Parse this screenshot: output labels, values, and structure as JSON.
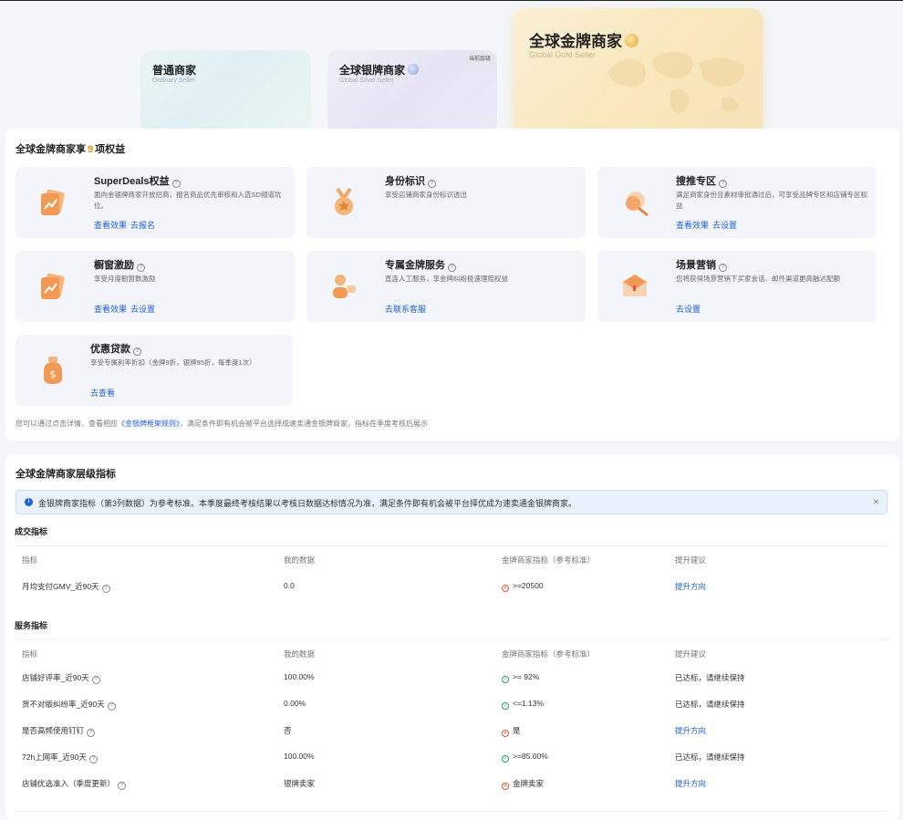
{
  "tiers": {
    "ordinary": {
      "name": "普通商家",
      "sub": "Ordinary Seller"
    },
    "silver": {
      "name": "全球银牌商家",
      "sub": "Global Silver Seller",
      "tag": "当前层级"
    },
    "gold": {
      "name": "全球金牌商家",
      "sub": "Global Gold Seller"
    }
  },
  "benefits": {
    "title_prefix": "全球金牌商家享",
    "count": "9",
    "title_suffix": "项权益",
    "items": [
      {
        "title": "SuperDeals权益",
        "desc": "面向金银牌商家开放招商，报名商品优先审核和入选SD频道坑位。",
        "links": [
          "查看效果",
          "去报名"
        ]
      },
      {
        "title": "身份标识",
        "desc": "享受店铺商家身份标识透出",
        "links": []
      },
      {
        "title": "搜推专区",
        "desc": "满足商家身份且素材审批通过后，可享受品牌专区和店铺专区权益",
        "links": [
          "查看效果",
          "去设置"
        ]
      },
      {
        "title": "橱窗激励",
        "desc": "享受月度橱窗数激励",
        "links": [
          "查看效果",
          "去设置"
        ]
      },
      {
        "title": "专属金牌服务",
        "desc": "直连人工服务，享金牌纠纷极速理赔权益",
        "links": [
          "去联系客服"
        ]
      },
      {
        "title": "场景营销",
        "desc": "您将获得场景营销下买家会话、邮件渠道更高触达配额",
        "links": [
          "去设置"
        ]
      },
      {
        "title": "优惠贷款",
        "desc": "享受专属利率折扣（金牌9折，银牌95折，每季度1次）",
        "links": [
          "去查看"
        ]
      }
    ],
    "footnote_a": "您可以通过点击详情，查看相应",
    "footnote_link": "《金银牌框架规则》",
    "footnote_b": "，满足条件即有机会被平台选择成速卖通金银牌商家，指标在季度考核后展示"
  },
  "metrics": {
    "title": "全球金牌商家层级指标",
    "alert": "金银牌商家指标（第3列数据）为参考标准。本季度最终考核结果以考核日数据达标情况为准，满足条件即有机会被平台择优成为速卖通金银牌商家。",
    "headers": [
      "指标",
      "我的数据",
      "金牌商家指标（参考标准）",
      "提升建议"
    ],
    "deal_section": "成交指标",
    "deal_rows": [
      {
        "metric": "月均支付GMV_近90天",
        "mine": "0.0",
        "standard": ">=20500",
        "status": "fail",
        "advice": "提升方向",
        "advice_link": true
      }
    ],
    "service_section": "服务指标",
    "service_rows": [
      {
        "metric": "店铺好评率_近90天",
        "mine": "100.00%",
        "standard": ">= 92%",
        "status": "pass",
        "advice": "已达标，请继续保持",
        "advice_link": false
      },
      {
        "metric": "货不对版纠纷率_近90天",
        "mine": "0.00%",
        "standard": "<=1.13%",
        "status": "pass",
        "advice": "已达标，请继续保持",
        "advice_link": false
      },
      {
        "metric": "是否高频使用钉钉",
        "mine": "否",
        "standard": "是",
        "status": "fail",
        "advice": "提升方向",
        "advice_link": true
      },
      {
        "metric": "72h上网率_近90天",
        "mine": "100.00%",
        "standard": ">=85.00%",
        "status": "pass",
        "advice": "已达标，请继续保持",
        "advice_link": false
      },
      {
        "metric": "店铺优选准入（季度更新）",
        "mine": "银牌卖家",
        "standard": "金牌卖家",
        "status": "fail",
        "advice": "提升方向",
        "advice_link": true
      }
    ]
  },
  "colors": {
    "accent": "#1f5fd6",
    "orange": "#f08c00",
    "pass": "#27a05a",
    "fail": "#e0553a"
  }
}
